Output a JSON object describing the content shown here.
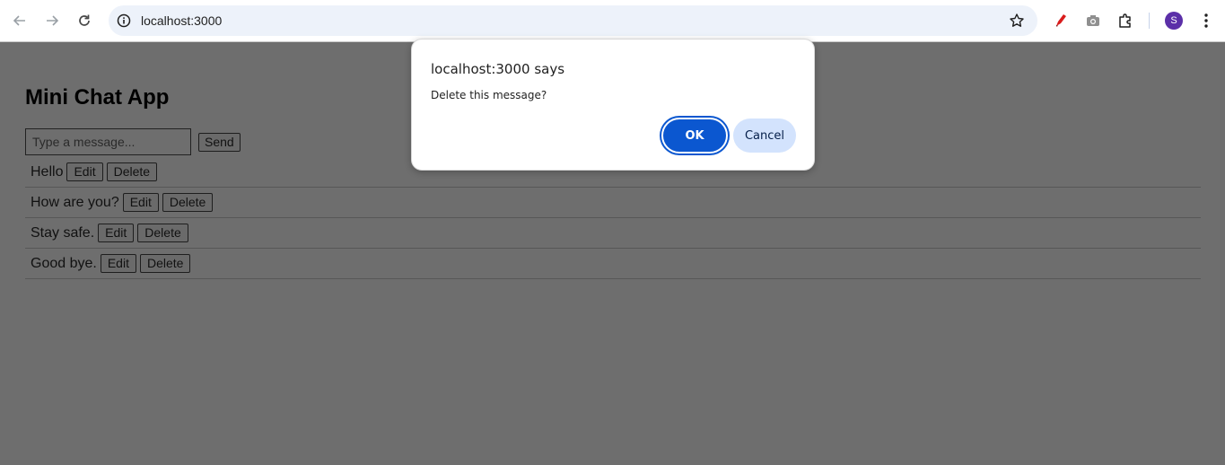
{
  "browser": {
    "url": "localhost:3000",
    "profile_initial": "S",
    "accent": "#0b57d0",
    "icons": [
      "back-arrow-icon",
      "forward-arrow-icon",
      "reload-icon",
      "site-info-icon",
      "bookmark-star-icon",
      "pen-extension-icon",
      "camera-extension-icon",
      "extensions-puzzle-icon",
      "more-menu-icon"
    ]
  },
  "page": {
    "title": "Mini Chat App",
    "input_placeholder": "Type a message...",
    "send_label": "Send",
    "edit_label": "Edit",
    "delete_label": "Delete",
    "messages": [
      {
        "text": "Hello"
      },
      {
        "text": "How are you?"
      },
      {
        "text": "Stay safe."
      },
      {
        "text": "Good bye."
      }
    ]
  },
  "dialog": {
    "title": "localhost:3000 says",
    "message": "Delete this message?",
    "ok_label": "OK",
    "cancel_label": "Cancel"
  }
}
